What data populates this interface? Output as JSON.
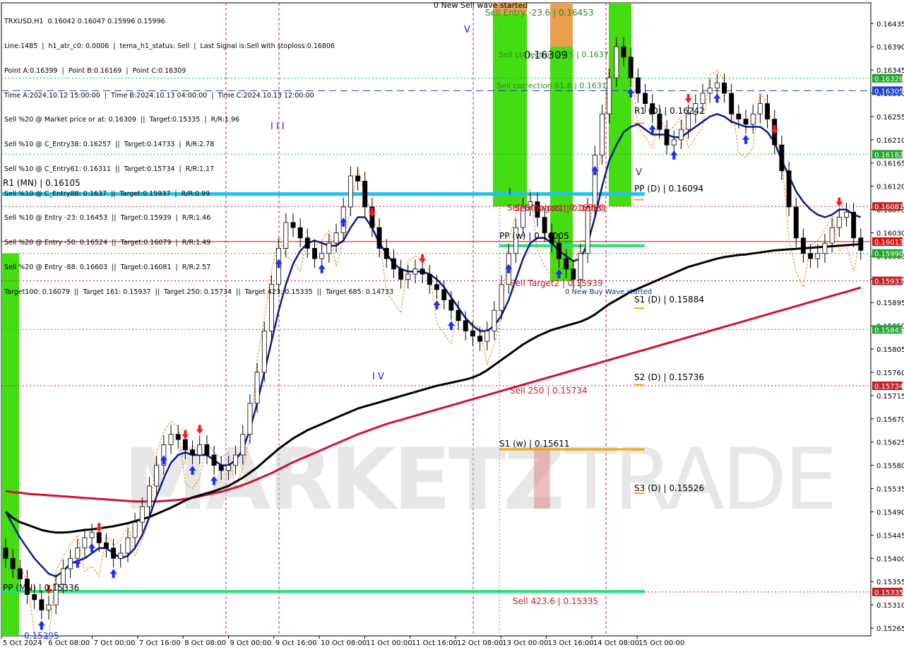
{
  "header": {
    "symbol_line": "TRXUSD,H1  0.16042 0.16047 0.15996 0.15996",
    "info_lines": [
      "Line:1485  |  h1_atr_c0: 0.0006  |  tema_h1_status: Sell  |  Last Signal is:Sell with stoploss:0.16806",
      "Point A:0.16399  |  Point B:0.16169  |  Point C:0.16309",
      "Time A:2024.10.12 15:00:00  |  Time B:2024.10.13 04:00:00  |  Time C:2024.10.13 12:00:00",
      "Sell %20 @ Market price or at: 0.16309  ||  Target:0.15335  |  R/R:1.96",
      "Sell %10 @ C_Entry38: 0.16257  ||  Target:0.14733  |  R/R:2.78",
      "Sell %10 @ C_Entry61: 0.16311  ||  Target:0.15734  |  R/R:1.17",
      "Sell %10 @ C_Entry88: 0.1637  ||  Target:0.15937  |  R/R:0.99",
      "Sell %10 @ Entry -23: 0.16453  ||  Target:0.15939  |  R/R:1.46",
      "Sell %20 @ Entry -50: 0.16524  ||  Target:0.16079  |  R/R:1.49",
      "Sell %20 @ Entry -88: 0.16603  ||  Target:0.16081  |  R/R:2.57",
      "Target100: 0.16079  ||  Target 161: 0.15937  ||  Target 250: 0.15734  ||  Target 423: 0.15335  ||  Target 685: 0.14733"
    ]
  },
  "watermark": {
    "part1": "MARKETZ",
    "part2": "I",
    "part3": "TRADE"
  },
  "colors": {
    "blue_line": "#0a1a8f",
    "black_ma": "#000000",
    "red_ma": "#d0103a",
    "cyan": "#1ec3f0",
    "green_line": "#22e07a",
    "orange": "#f5a300",
    "green_zone": "#44dd11",
    "orange_zone": "#e8a050",
    "stop_orange": "#f08020",
    "up_arrow": "#1a2cff",
    "down_arrow": "#ff1a1a",
    "candle": "#000000"
  },
  "chart_data": {
    "type": "candlestick",
    "symbol": "TRXUSD",
    "timeframe": "H1",
    "ylim": [
      0.1525,
      0.16475
    ],
    "y_ticks": [
      0.16435,
      0.1639,
      0.16345,
      0.163,
      0.16255,
      0.1621,
      0.16165,
      0.1612,
      0.16075,
      0.1603,
      0.15985,
      0.1594,
      0.15895,
      0.1585,
      0.15805,
      0.1576,
      0.15715,
      0.1567,
      0.15625,
      0.1558,
      0.15535,
      0.1549,
      0.15445,
      0.154,
      0.15355,
      0.1531,
      0.15265
    ],
    "y_tick_labels": [
      "0.16435",
      "0.16390",
      "0.16345",
      "0.16300",
      "0.16255",
      "0.16210",
      "0.16165",
      "0.16120",
      "0.16075",
      "0.16030",
      "0.15985",
      "0.15940",
      "0.15895",
      "0.15850",
      "0.15805",
      "0.15760",
      "0.15715",
      "0.15670",
      "0.15625",
      "0.15580",
      "0.15535",
      "0.15490",
      "0.15445",
      "0.15400",
      "0.15355",
      "0.15310",
      "0.15265"
    ],
    "x_labels": [
      "5 Oct 2024",
      "6 Oct 08:00",
      "7 Oct 00:00",
      "7 Oct 16:00",
      "8 Oct 08:00",
      "9 Oct 00:00",
      "9 Oct 16:00",
      "10 Oct 08:00",
      "11 Oct 00:00",
      "11 Oct 16:00",
      "12 Oct 08:00",
      "13 Oct 00:00",
      "13 Oct 16:00",
      "14 Oct 08:00",
      "15 Oct 00:00"
    ],
    "price_badges": [
      {
        "value": 0.16329,
        "text": "0.16329",
        "color": "#22a52c"
      },
      {
        "value": 0.16305,
        "text": "0.16305",
        "color": "#1d3fcf"
      },
      {
        "value": 0.16182,
        "text": "0.16182",
        "color": "#22a52c"
      },
      {
        "value": 0.16081,
        "text": "0.16081",
        "color": "#c0202a"
      },
      {
        "value": 0.16013,
        "text": "0.16013",
        "color": "#e01010"
      },
      {
        "value": 0.1599,
        "text": "0.15990",
        "color": "#22a52c"
      },
      {
        "value": 0.15937,
        "text": "0.15937",
        "color": "#c0202a"
      },
      {
        "value": 0.15843,
        "text": "0.15843",
        "color": "#22a52c"
      },
      {
        "value": 0.15734,
        "text": "0.15734",
        "color": "#c0202a"
      },
      {
        "value": 0.15335,
        "text": "0.15335",
        "color": "#c0202a"
      }
    ],
    "levels": [
      {
        "label": "R1 (MN) | 0.16105",
        "value": 0.16105
      },
      {
        "label": "R1 (D) | 0.16242",
        "value": 0.16242
      },
      {
        "label": "PP (D) | 0.16094",
        "value": 0.16094
      },
      {
        "label": "PP (w) | 0.16005",
        "value": 0.16005
      },
      {
        "label": "S1 (D) | 0.15884",
        "value": 0.15884
      },
      {
        "label": "S2 (D) | 0.15736",
        "value": 0.15736
      },
      {
        "label": "S1 (w) | 0.15611",
        "value": 0.15611
      },
      {
        "label": "S3 (D) | 0.15526",
        "value": 0.15526
      },
      {
        "label": "PP (MN) | 0.15336",
        "value": 0.15336
      }
    ],
    "annotations": [
      "0 New Sell wave started",
      "Sell Entry -23.6 | 0.16453",
      "Sell correction 61.8 | 0.1631",
      "Sell correction 87.5 | 0.1637",
      "0.16309",
      "Sell Target1 | 0.16081",
      "Sell Target2 | 0.15939",
      "0 New Buy Wave started",
      "Sell 250 | 0.15734",
      "Sell 423.6 | 0.15335",
      "Sell Stoploss | 0.16806",
      "0.15295"
    ],
    "wave_labels": [
      "V",
      "I I I",
      "I V",
      "V",
      "I"
    ],
    "series": [
      {
        "name": "price",
        "type": "candlestick",
        "close": [
          0.154,
          0.1538,
          0.1536,
          0.1533,
          0.1532,
          0.153,
          0.1531,
          0.1535,
          0.1538,
          0.154,
          0.1542,
          0.1544,
          0.1545,
          0.1543,
          0.1542,
          0.154,
          0.1541,
          0.1544,
          0.1547,
          0.155,
          0.1554,
          0.1558,
          0.1562,
          0.1564,
          0.1563,
          0.1561,
          0.156,
          0.1562,
          0.156,
          0.1558,
          0.1557,
          0.1558,
          0.156,
          0.1564,
          0.157,
          0.1576,
          0.1584,
          0.1593,
          0.16,
          0.1605,
          0.1604,
          0.1602,
          0.16,
          0.1598,
          0.1599,
          0.1601,
          0.1603,
          0.1608,
          0.1614,
          0.1613,
          0.1608,
          0.1604,
          0.16,
          0.1598,
          0.1596,
          0.1594,
          0.1595,
          0.1596,
          0.1595,
          0.1593,
          0.1592,
          0.159,
          0.1588,
          0.1586,
          0.1584,
          0.1583,
          0.1582,
          0.1584,
          0.1588,
          0.1593,
          0.1599,
          0.1604,
          0.1608,
          0.1609,
          0.1606,
          0.1603,
          0.1601,
          0.1598,
          0.1596,
          0.1594,
          0.1599,
          0.1608,
          0.1618,
          0.1626,
          0.1633,
          0.1639,
          0.1637,
          0.1633,
          0.163,
          0.1628,
          0.1626,
          0.1623,
          0.162,
          0.1621,
          0.1623,
          0.1626,
          0.1628,
          0.163,
          0.1631,
          0.1632,
          0.163,
          0.1626,
          0.1625,
          0.1624,
          0.1626,
          0.1628,
          0.1625,
          0.162,
          0.1615,
          0.1608,
          0.1602,
          0.1599,
          0.1598,
          0.1599,
          0.1601,
          0.1604,
          0.1606,
          0.1607,
          0.1602,
          0.15996
        ]
      },
      {
        "name": "fast",
        "type": "line",
        "values": [
          0.1549,
          0.15465,
          0.1544,
          0.1542,
          0.154,
          0.15385,
          0.1537,
          0.15365,
          0.15375,
          0.1539,
          0.15395,
          0.154,
          0.1541,
          0.1542,
          0.1542,
          0.1541,
          0.154,
          0.15405,
          0.1542,
          0.15445,
          0.1548,
          0.1552,
          0.15555,
          0.15585,
          0.156,
          0.15605,
          0.156,
          0.156,
          0.156,
          0.1559,
          0.1558,
          0.1558,
          0.1559,
          0.1561,
          0.1565,
          0.157,
          0.1576,
          0.1582,
          0.1588,
          0.1593,
          0.1597,
          0.15995,
          0.1601,
          0.16015,
          0.1601,
          0.16005,
          0.16005,
          0.16015,
          0.1604,
          0.1606,
          0.1606,
          0.1604,
          0.1601,
          0.1599,
          0.1597,
          0.1596,
          0.15955,
          0.15955,
          0.15955,
          0.1595,
          0.1594,
          0.15925,
          0.15905,
          0.15885,
          0.15865,
          0.1585,
          0.1584,
          0.1584,
          0.1585,
          0.1587,
          0.159,
          0.1594,
          0.1598,
          0.1601,
          0.1602,
          0.1602,
          0.1601,
          0.15995,
          0.15985,
          0.15975,
          0.1598,
          0.1601,
          0.1606,
          0.1612,
          0.1617,
          0.162,
          0.16225,
          0.16235,
          0.1624,
          0.1623,
          0.1622,
          0.1622,
          0.1622,
          0.16215,
          0.16215,
          0.16225,
          0.16235,
          0.16245,
          0.16255,
          0.1626,
          0.16255,
          0.16245,
          0.1624,
          0.16235,
          0.16235,
          0.16235,
          0.16225,
          0.16205,
          0.1617,
          0.1614,
          0.1611,
          0.1609,
          0.16075,
          0.16065,
          0.1606,
          0.16065,
          0.16075,
          0.16075,
          0.16065,
          0.1606
        ]
      },
      {
        "name": "slow",
        "type": "line",
        "values": [
          0.1549,
          0.15478,
          0.1547,
          0.15465,
          0.1546,
          0.15455,
          0.15452,
          0.1545,
          0.1545,
          0.15451,
          0.15453,
          0.15455,
          0.15456,
          0.15458,
          0.1546,
          0.15462,
          0.15465,
          0.15468,
          0.15472,
          0.15476,
          0.1548,
          0.15486,
          0.15492,
          0.15498,
          0.15505,
          0.15512,
          0.15518,
          0.15522,
          0.15526,
          0.1553,
          0.15535,
          0.1554,
          0.15548,
          0.15556,
          0.15566,
          0.15576,
          0.15588,
          0.156,
          0.15612,
          0.15622,
          0.15632,
          0.1564,
          0.15648,
          0.15654,
          0.1566,
          0.15666,
          0.15672,
          0.15678,
          0.15684,
          0.1569,
          0.15694,
          0.15698,
          0.15702,
          0.15706,
          0.1571,
          0.15714,
          0.15718,
          0.15722,
          0.15726,
          0.1573,
          0.15734,
          0.15737,
          0.1574,
          0.15743,
          0.15746,
          0.1575,
          0.15756,
          0.15764,
          0.15774,
          0.15784,
          0.15794,
          0.15804,
          0.15814,
          0.15822,
          0.1583,
          0.15836,
          0.15842,
          0.15846,
          0.1585,
          0.15854,
          0.15858,
          0.15864,
          0.15872,
          0.15882,
          0.15892,
          0.159,
          0.15908,
          0.15916,
          0.15922,
          0.15928,
          0.15934,
          0.1594,
          0.15946,
          0.15952,
          0.15958,
          0.15964,
          0.15968,
          0.15972,
          0.15976,
          0.1598,
          0.15983,
          0.15985,
          0.15987,
          0.15988,
          0.1599,
          0.15992,
          0.15994,
          0.15996,
          0.15997,
          0.15998,
          0.15999,
          0.16,
          0.16001,
          0.16002,
          0.16003,
          0.16004,
          0.16005,
          0.16006,
          0.16007,
          0.16008
        ]
      },
      {
        "name": "trend",
        "type": "line",
        "values": [
          0.1553,
          0.15528,
          0.15527,
          0.15525,
          0.15524,
          0.15523,
          0.15522,
          0.15521,
          0.1552,
          0.15519,
          0.15518,
          0.15517,
          0.15516,
          0.15515,
          0.15514,
          0.15513,
          0.15512,
          0.15511,
          0.1551,
          0.1551,
          0.1551,
          0.1551,
          0.15511,
          0.15512,
          0.15513,
          0.15515,
          0.15517,
          0.1552,
          0.15523,
          0.15526,
          0.15529,
          0.15533,
          0.15537,
          0.15542,
          0.15547,
          0.15553,
          0.15559,
          0.15565,
          0.15572,
          0.15579,
          0.15586,
          0.15592,
          0.15598,
          0.15604,
          0.1561,
          0.15616,
          0.15622,
          0.15628,
          0.15634,
          0.1564,
          0.15645,
          0.1565,
          0.15655,
          0.1566,
          0.15664,
          0.15668,
          0.15672,
          0.15676,
          0.1568,
          0.15684,
          0.15688,
          0.15692,
          0.15696,
          0.157,
          0.15704,
          0.15708,
          0.15712,
          0.15716,
          0.1572,
          0.15724,
          0.15728,
          0.15732,
          0.15736,
          0.1574,
          0.15744,
          0.15748,
          0.15752,
          0.15756,
          0.1576,
          0.15764,
          0.15768,
          0.15772,
          0.15776,
          0.1578,
          0.15784,
          0.15788,
          0.15792,
          0.15796,
          0.158,
          0.15804,
          0.15808,
          0.15812,
          0.15816,
          0.1582,
          0.15824,
          0.15828,
          0.15832,
          0.15836,
          0.1584,
          0.15844,
          0.15848,
          0.15852,
          0.15856,
          0.1586,
          0.15864,
          0.15868,
          0.15872,
          0.15876,
          0.1588,
          0.15884,
          0.15888,
          0.15892,
          0.15896,
          0.159,
          0.15904,
          0.15908,
          0.15912,
          0.15916,
          0.1592,
          0.15924
        ]
      }
    ],
    "signals": {
      "up": [
        5,
        10,
        12,
        15,
        22,
        26,
        29,
        38,
        44,
        47,
        60,
        62,
        70,
        77,
        82,
        87,
        90,
        93,
        99,
        103
      ],
      "down": [
        6,
        13,
        25,
        27,
        51,
        58,
        95,
        107,
        116
      ]
    }
  }
}
